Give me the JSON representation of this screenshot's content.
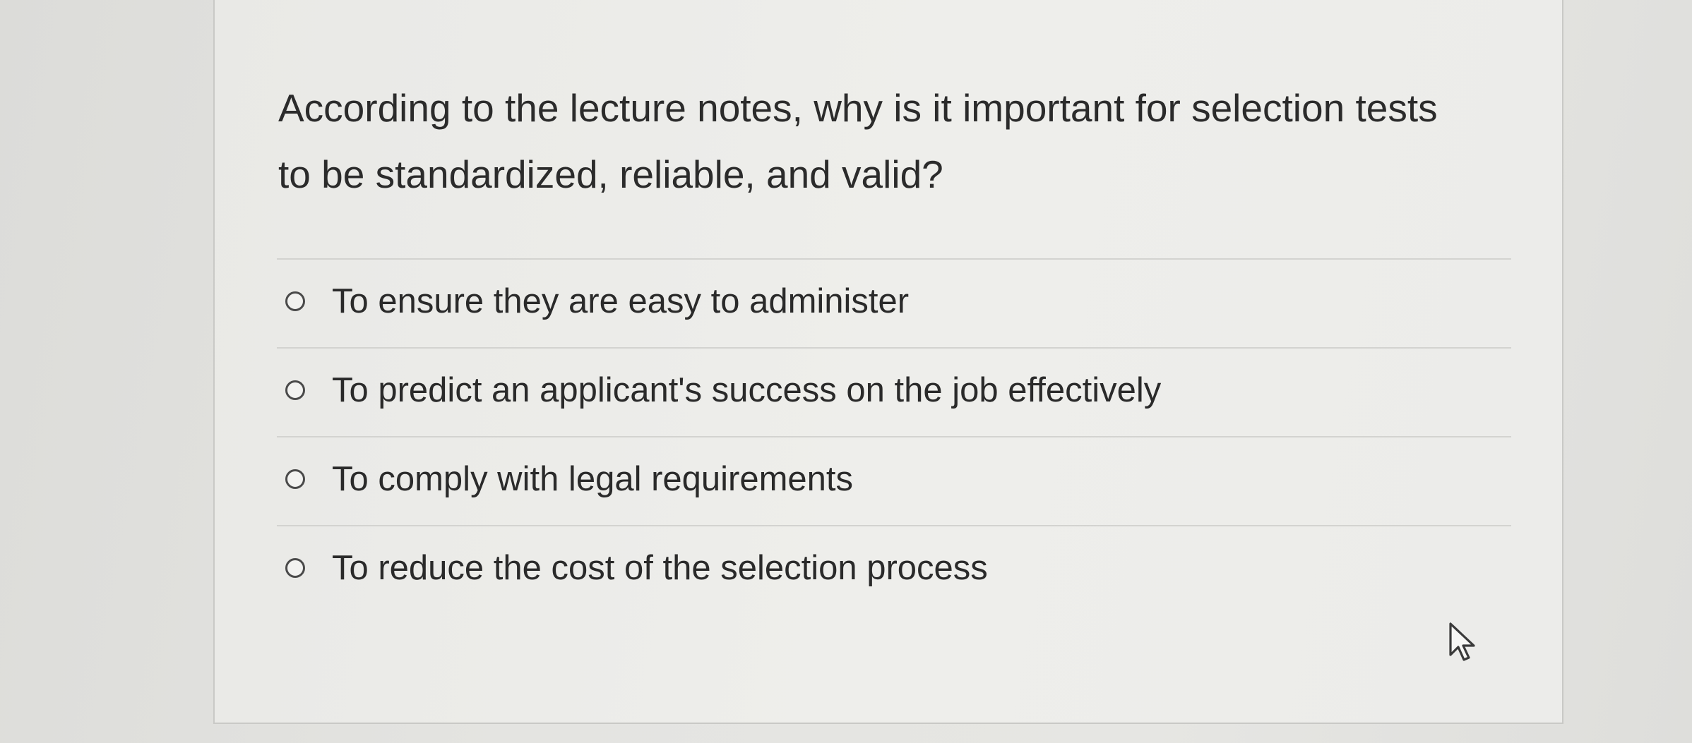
{
  "question": {
    "text": "According to the lecture notes, why is it important for selection tests to be standardized, reliable, and valid?"
  },
  "answers": [
    {
      "label": "To ensure they are easy to administer",
      "selected": false
    },
    {
      "label": "To predict an applicant's success on the job effectively",
      "selected": false
    },
    {
      "label": "To comply with legal requirements",
      "selected": false
    },
    {
      "label": "To reduce the cost of the selection process",
      "selected": false
    }
  ],
  "cursor": {
    "icon": "arrow-pointer-icon"
  }
}
